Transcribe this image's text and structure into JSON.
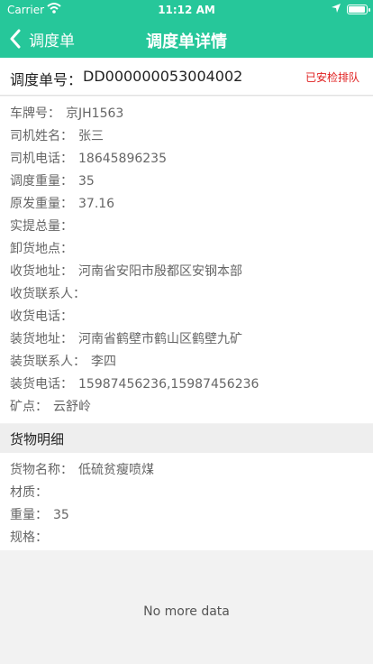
{
  "status_bar": {
    "carrier": "Carrier",
    "time": "11:12 AM"
  },
  "nav": {
    "back_label": "调度单",
    "title": "调度单详情"
  },
  "order": {
    "label": "调度单号：",
    "number": "DD000000053004002",
    "status": "已安检排队"
  },
  "details": [
    {
      "label": "车牌号：",
      "value": "京JH1563"
    },
    {
      "label": "司机姓名：",
      "value": "张三"
    },
    {
      "label": "司机电话：",
      "value": "18645896235"
    },
    {
      "label": "调度重量：",
      "value": "35"
    },
    {
      "label": "原发重量：",
      "value": "37.16"
    },
    {
      "label": "实提总量：",
      "value": ""
    },
    {
      "label": "卸货地点：",
      "value": ""
    },
    {
      "label": "收货地址：",
      "value": "河南省安阳市殷都区安钢本部"
    },
    {
      "label": "收货联系人：",
      "value": ""
    },
    {
      "label": "收货电话：",
      "value": ""
    },
    {
      "label": "装货地址：",
      "value": "河南省鹤壁市鹤山区鹤壁九矿"
    },
    {
      "label": "装货联系人：",
      "value": "李四"
    },
    {
      "label": "装货电话：",
      "value": "15987456236,15987456236"
    },
    {
      "label": "矿点：",
      "value": "云舒岭"
    }
  ],
  "goods_section": {
    "title": "货物明细"
  },
  "goods": [
    {
      "label": "货物名称：",
      "value": "低硫贫瘦喷煤"
    },
    {
      "label": "材质：",
      "value": ""
    },
    {
      "label": "重量：",
      "value": "35"
    },
    {
      "label": "规格：",
      "value": ""
    }
  ],
  "footer": {
    "no_more": "No more data"
  },
  "colors": {
    "primary": "#26c79a",
    "status_red": "#e02020"
  }
}
